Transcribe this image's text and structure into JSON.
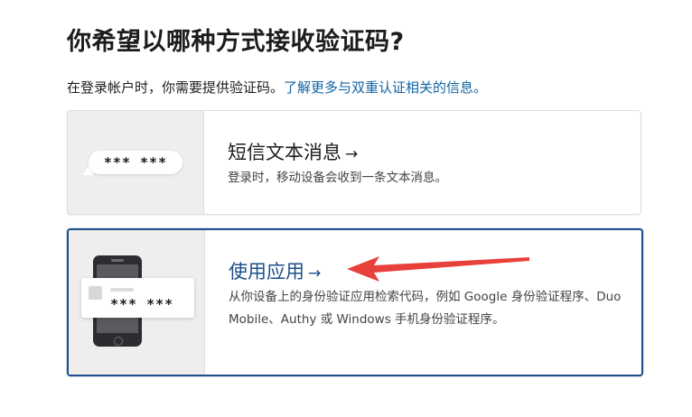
{
  "page": {
    "title": "你希望以哪种方式接收验证码?",
    "subtitle_text": "在登录帐户时，你需要提供验证码。",
    "subtitle_link": "了解更多与双重认证相关的信息。"
  },
  "options": {
    "sms": {
      "title": "短信文本消息",
      "arrow": "→",
      "description": "登录时，移动设备会收到一条文本消息。",
      "illustration_code": "*** ***"
    },
    "app": {
      "title": "使用应用",
      "arrow": "→",
      "description": "从你设备上的身份验证应用检索代码，例如 Google 身份验证程序、Duo Mobile、Authy 或 Windows 手机身份验证程序。",
      "illustration_code": "*** ***",
      "selected": true
    }
  },
  "colors": {
    "link": "#1264a3",
    "selected_border": "#1d4e89",
    "annotation_arrow": "#e8413b",
    "illustration_bg": "#efeeec"
  },
  "icons": {
    "sms_illustration": "chat-bubble-code-icon",
    "app_illustration": "phone-code-icon",
    "annotation": "red-arrow-icon"
  }
}
